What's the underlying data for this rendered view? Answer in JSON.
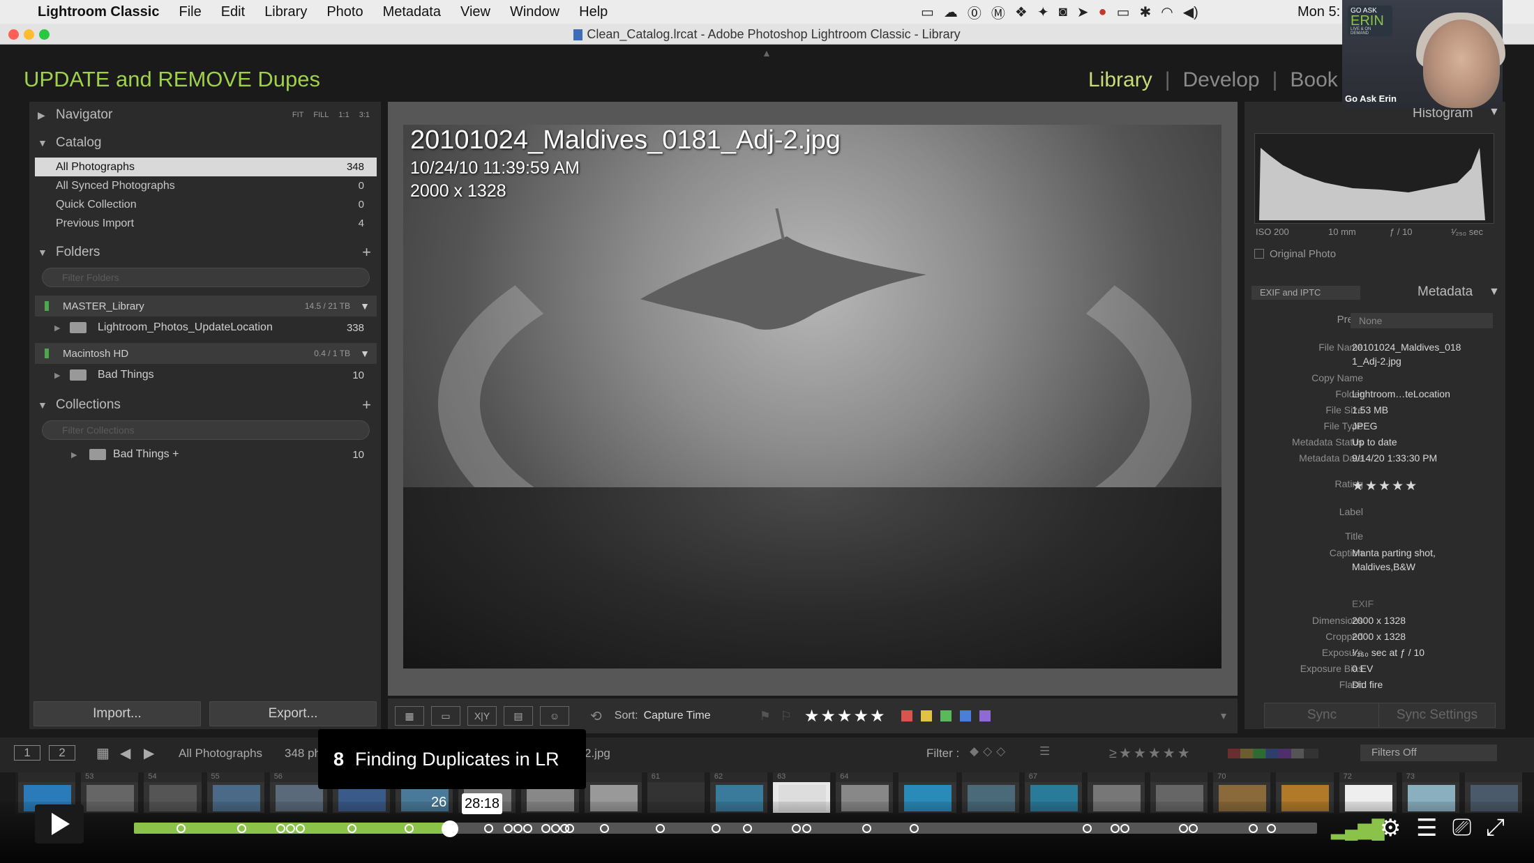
{
  "menubar": {
    "app": "Lightroom Classic",
    "items": [
      "File",
      "Edit",
      "Library",
      "Photo",
      "Metadata",
      "View",
      "Window",
      "Help"
    ],
    "clock": "Mon 5:"
  },
  "window": {
    "title": "Clean_Catalog.lrcat - Adobe Photoshop Lightroom Classic - Library"
  },
  "identity_plate": "UPDATE and REMOVE Dupes",
  "modules": {
    "library": "Library",
    "develop": "Develop",
    "book": "Book",
    "sep": "|"
  },
  "navigator": {
    "title": "Navigator",
    "zoom": [
      "FIT",
      "FILL",
      "1:1",
      "3:1"
    ]
  },
  "catalog": {
    "title": "Catalog",
    "items": [
      {
        "label": "All Photographs",
        "count": "348"
      },
      {
        "label": "All Synced Photographs",
        "count": "0"
      },
      {
        "label": "Quick Collection",
        "count": "0"
      },
      {
        "label": "Previous Import",
        "count": "4"
      }
    ]
  },
  "folders": {
    "title": "Folders",
    "filter_placeholder": "Filter Folders",
    "volumes": [
      {
        "name": "MASTER_Library",
        "space": "14.5 / 21 TB",
        "folders": [
          {
            "name": "Lightroom_Photos_UpdateLocation",
            "count": "338"
          }
        ]
      },
      {
        "name": "Macintosh HD",
        "space": "0.4 / 1 TB",
        "folders": [
          {
            "name": "Bad Things",
            "count": "10"
          }
        ]
      }
    ]
  },
  "collections": {
    "title": "Collections",
    "filter_placeholder": "Filter Collections",
    "items": [
      {
        "label": "Bad Things +",
        "count": "10"
      }
    ]
  },
  "left_buttons": {
    "import": "Import...",
    "export": "Export..."
  },
  "loupe": {
    "filename": "20101024_Maldives_0181_Adj-2.jpg",
    "datetime": "10/24/10 11:39:59 AM",
    "dimensions": "2000 x 1328"
  },
  "toolbar": {
    "sort_label": "Sort:",
    "sort_value": "Capture Time",
    "stars": "★★★★★",
    "label_colors": [
      "#d9534f",
      "#e0c341",
      "#5cb85c",
      "#4a7fd8",
      "#8e6ad8"
    ]
  },
  "histogram": {
    "title": "Histogram",
    "iso": "ISO 200",
    "focal": "10 mm",
    "aperture": "ƒ / 10",
    "shutter": "¹⁄₂₅₀ sec",
    "original_photo": "Original Photo"
  },
  "metadata": {
    "preset_dropdown": "EXIF and IPTC",
    "title": "Metadata",
    "preset_label": "Preset",
    "preset_value": "None",
    "fields": [
      {
        "k": "File Name",
        "v": "20101024_Maldives_018"
      },
      {
        "k": "",
        "v": "1_Adj-2.jpg"
      },
      {
        "k": "Copy Name",
        "v": ""
      },
      {
        "k": "Folder",
        "v": "Lightroom…teLocation"
      },
      {
        "k": "File Size",
        "v": "1.53 MB"
      },
      {
        "k": "File Type",
        "v": "JPEG"
      },
      {
        "k": "Metadata Status",
        "v": "Up to date"
      },
      {
        "k": "Metadata Date",
        "v": "9/14/20 1:33:30 PM"
      },
      {
        "k": "Rating",
        "v": "★★★★★"
      },
      {
        "k": "Label",
        "v": ""
      },
      {
        "k": "Title",
        "v": ""
      },
      {
        "k": "Caption",
        "v": "Manta parting shot,"
      },
      {
        "k": "",
        "v": "Maldives,B&W"
      },
      {
        "k": "",
        "v": "EXIF"
      },
      {
        "k": "Dimensions",
        "v": "2000 x 1328"
      },
      {
        "k": "Cropped",
        "v": "2000 x 1328"
      },
      {
        "k": "Exposure",
        "v": "¹⁄₂₅₀ sec at ƒ / 10"
      },
      {
        "k": "Exposure Bias",
        "v": "0 EV"
      },
      {
        "k": "Flash",
        "v": "Did fire"
      }
    ],
    "sync": "Sync",
    "sync_settings": "Sync Settings"
  },
  "filmbar": {
    "screen1": "1",
    "screen2": "2",
    "source": "All Photographs",
    "count_partial": "348 ph",
    "file_partial": "2.jpg",
    "filter_label": "Filter :",
    "filters_off": "Filters Off"
  },
  "filmstrip": {
    "numbers": [
      "",
      "53",
      "54",
      "55",
      "56",
      "",
      "",
      "",
      "",
      "",
      "61",
      "62",
      "63",
      "64",
      "",
      "",
      "67",
      "",
      "",
      "70",
      "",
      "72",
      "73",
      ""
    ]
  },
  "video": {
    "chapter_num": "8",
    "chapter_title": "Finding Duplicates in LR",
    "time_left": "26",
    "time": "28:18",
    "progress": 0.267
  },
  "webcam": {
    "brand_top": "GO ASK",
    "brand": "ERIN",
    "brand_sub": "LIVE & ON DEMAND",
    "caption": "Go Ask Erin"
  }
}
